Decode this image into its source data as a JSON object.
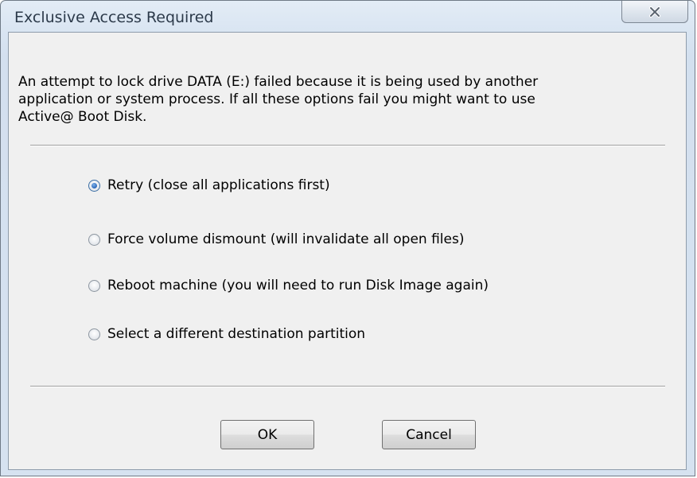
{
  "window": {
    "title": "Exclusive Access Required"
  },
  "titlebar": {
    "close_icon": "close-icon"
  },
  "message": "An attempt to lock drive DATA (E:) failed because it is being used by another\napplication or system process. If all these options fail you might want to use\nActive@ Boot Disk.",
  "options": [
    {
      "label": "Retry (close all applications first)",
      "checked": true
    },
    {
      "label": "Force volume dismount (will invalidate all open files)",
      "checked": false
    },
    {
      "label": "Reboot machine (you will need to run Disk Image again)",
      "checked": false
    },
    {
      "label": "Select a different destination partition",
      "checked": false
    }
  ],
  "buttons": {
    "ok_label": "OK",
    "cancel_label": "Cancel"
  },
  "colors": {
    "titlebar": "#d9e5f2",
    "client_background": "#f0f0f0",
    "radio_selected": "#2a66b8"
  }
}
